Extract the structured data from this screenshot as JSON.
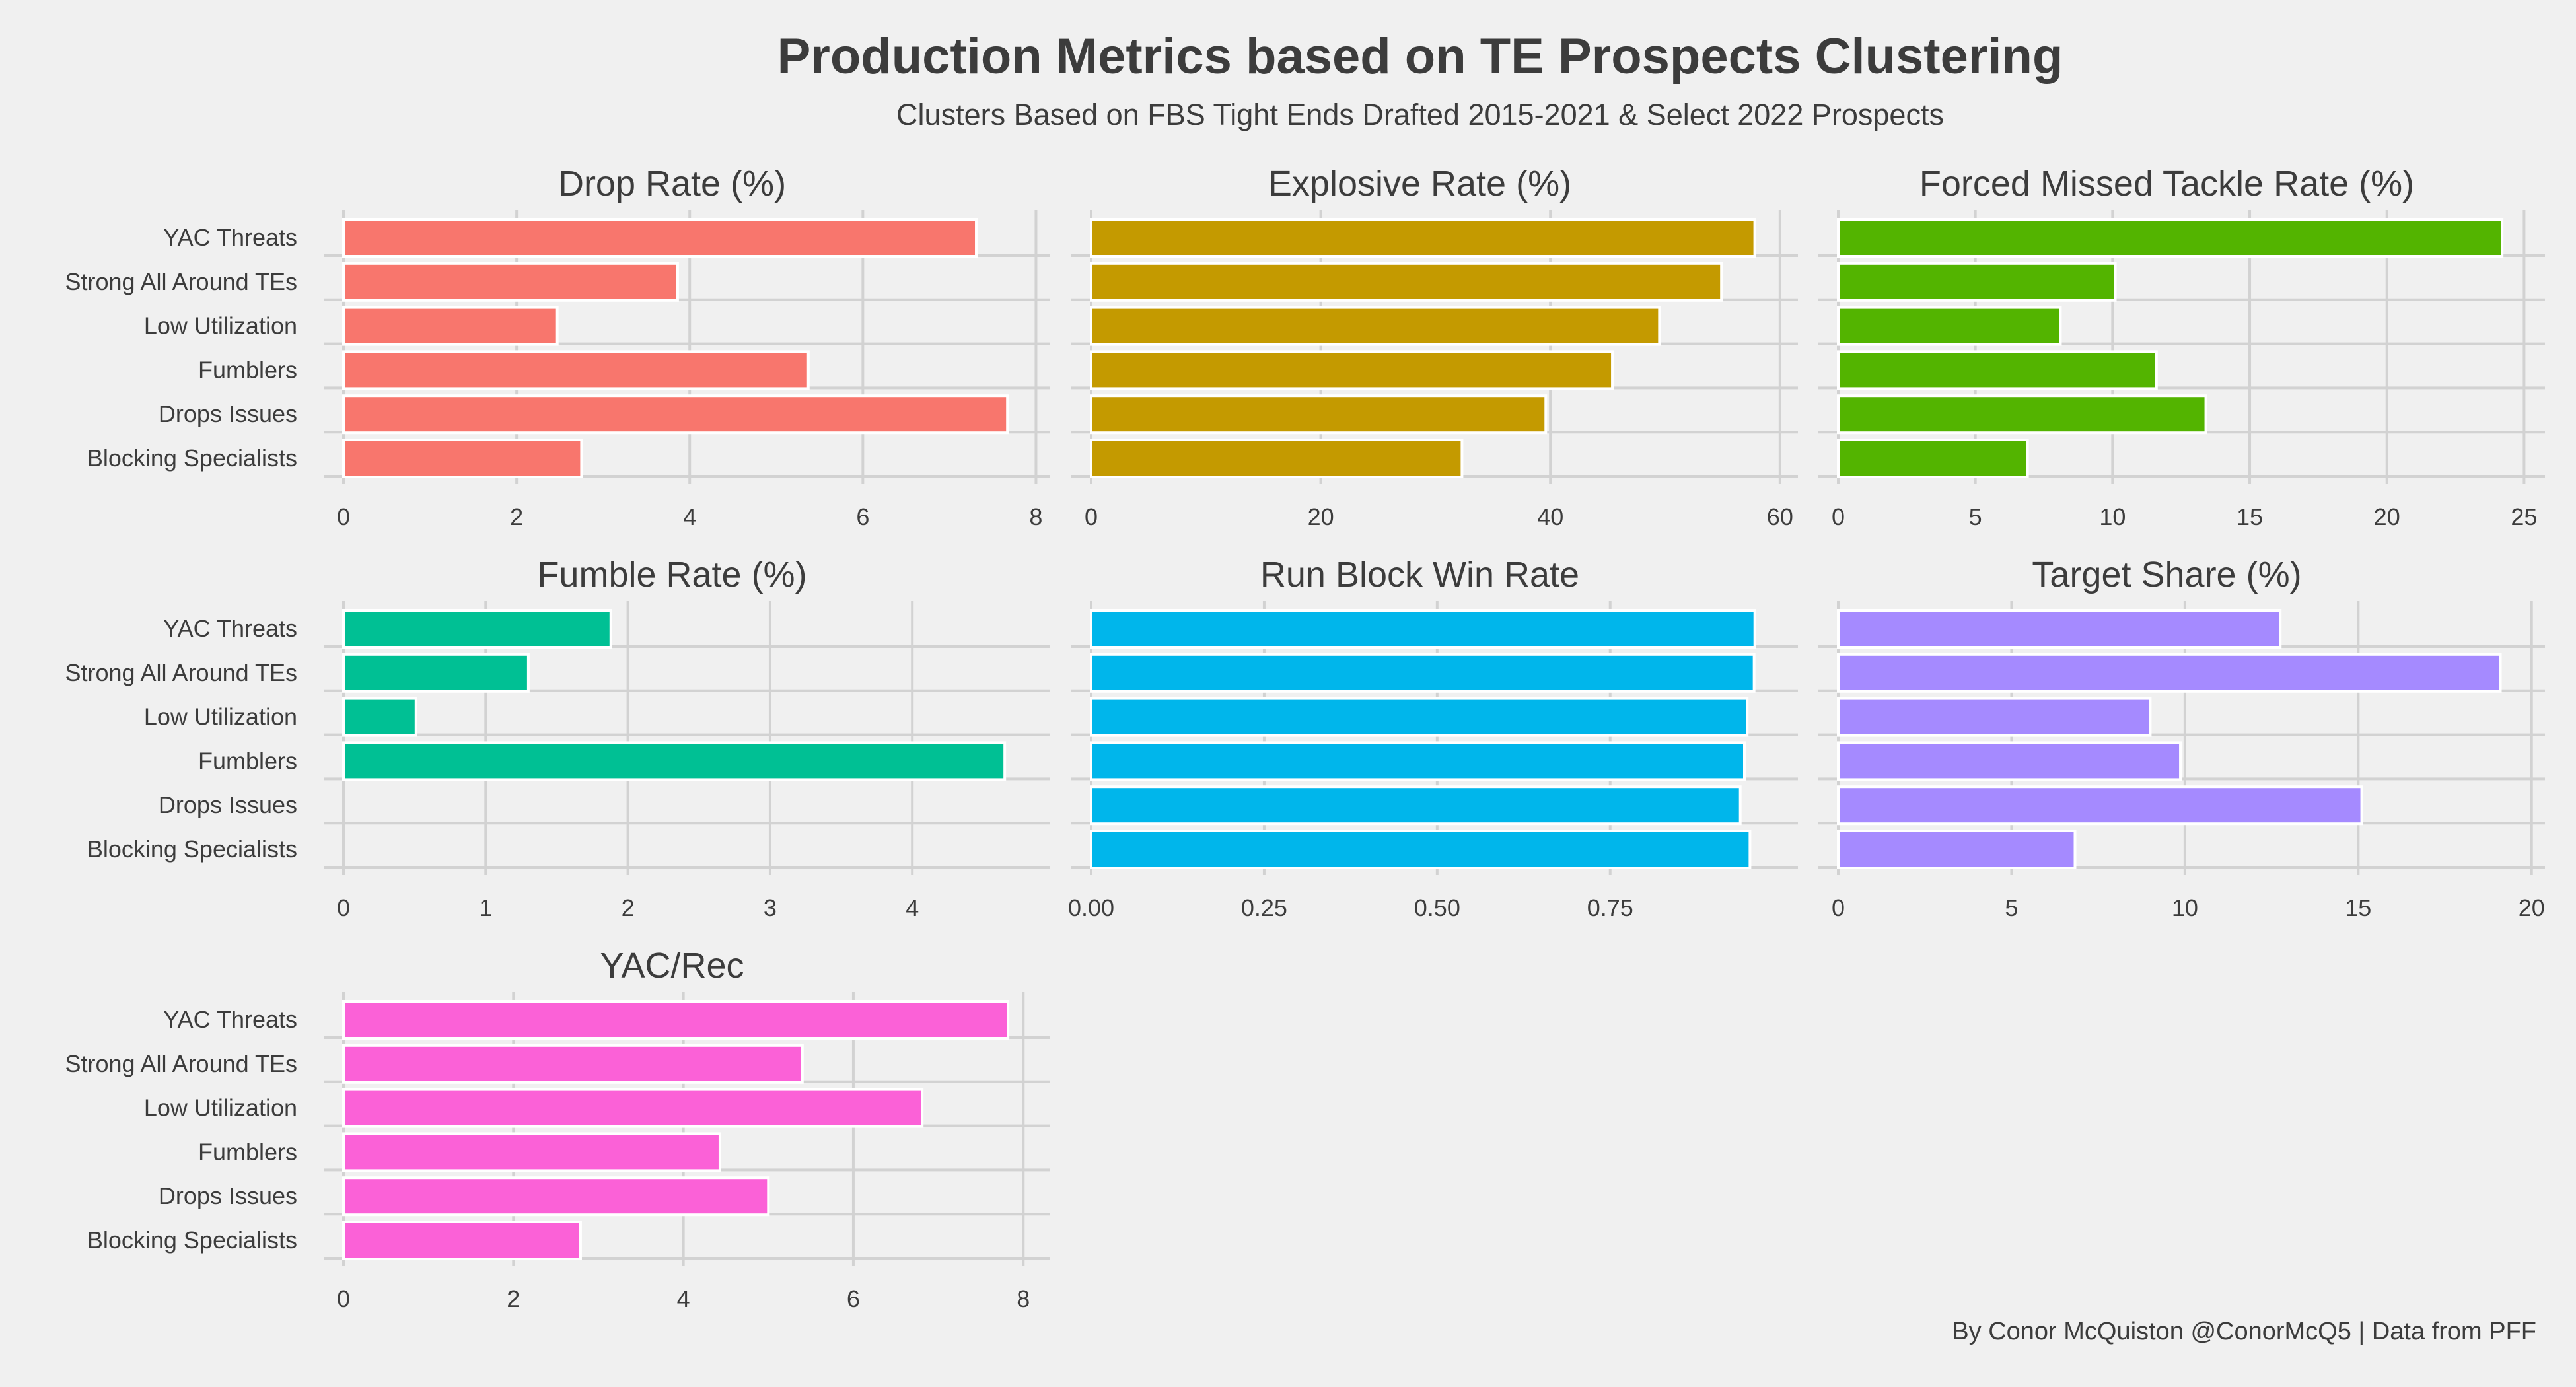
{
  "header": {
    "title": "Production Metrics based on TE Prospects Clustering",
    "subtitle": "Clusters Based on FBS Tight Ends Drafted 2015-2021 & Select 2022 Prospects"
  },
  "footer": {
    "caption": "By Conor McQuiston @ConorMcQ5 | Data from PFF"
  },
  "chart_data": [
    {
      "type": "bar",
      "orientation": "horizontal",
      "title": "Drop Rate (%)",
      "color": "#F8766D",
      "categories": [
        "YAC Threats",
        "Strong All Around TEs",
        "Low Utilization",
        "Fumblers",
        "Drops Issues",
        "Blocking Specialists"
      ],
      "values": [
        7.31,
        3.86,
        2.47,
        5.37,
        7.67,
        2.75
      ],
      "xlim": [
        0,
        8.05
      ],
      "ticks": [
        0,
        2,
        4,
        6,
        8
      ],
      "tick_labels": [
        "0",
        "2",
        "4",
        "6",
        "8"
      ],
      "grid": true
    },
    {
      "type": "bar",
      "orientation": "horizontal",
      "title": "Explosive Rate (%)",
      "color": "#C49A00",
      "categories": [
        "YAC Threats",
        "Strong All Around TEs",
        "Low Utilization",
        "Fumblers",
        "Drops Issues",
        "Blocking Specialists"
      ],
      "values": [
        57.8,
        54.9,
        49.5,
        45.4,
        39.6,
        32.3
      ],
      "xlim": [
        0,
        60.7
      ],
      "ticks": [
        0,
        20,
        40,
        60
      ],
      "tick_labels": [
        "0",
        "20",
        "40",
        "60"
      ],
      "grid": true
    },
    {
      "type": "bar",
      "orientation": "horizontal",
      "title": "Forced Missed Tackle Rate (%)",
      "color": "#53B400",
      "categories": [
        "YAC Threats",
        "Strong All Around TEs",
        "Low Utilization",
        "Fumblers",
        "Drops Issues",
        "Blocking Specialists"
      ],
      "values": [
        24.2,
        10.1,
        8.1,
        11.6,
        13.4,
        6.9
      ],
      "xlim": [
        0,
        25.4
      ],
      "ticks": [
        0,
        5,
        10,
        15,
        20,
        25
      ],
      "tick_labels": [
        "0",
        "5",
        "10",
        "15",
        "20",
        "25"
      ],
      "grid": true
    },
    {
      "type": "bar",
      "orientation": "horizontal",
      "title": "Fumble Rate (%)",
      "color": "#00C094",
      "categories": [
        "YAC Threats",
        "Strong All Around TEs",
        "Low Utilization",
        "Fumblers",
        "Drops Issues",
        "Blocking Specialists"
      ],
      "values": [
        1.88,
        1.3,
        0.51,
        4.65,
        0.0,
        0.0
      ],
      "xlim": [
        0,
        4.9
      ],
      "ticks": [
        0,
        1,
        2,
        3,
        4
      ],
      "tick_labels": [
        "0",
        "1",
        "2",
        "3",
        "4"
      ],
      "grid": true
    },
    {
      "type": "bar",
      "orientation": "horizontal",
      "title": "Run Block Win Rate",
      "color": "#00B6EB",
      "categories": [
        "YAC Threats",
        "Strong All Around TEs",
        "Low Utilization",
        "Fumblers",
        "Drops Issues",
        "Blocking Specialists"
      ],
      "values": [
        0.959,
        0.958,
        0.948,
        0.944,
        0.938,
        0.952
      ],
      "xlim": [
        0,
        1.007
      ],
      "ticks": [
        0,
        0.25,
        0.5,
        0.75
      ],
      "tick_labels": [
        "0.00",
        "0.25",
        "0.50",
        "0.75"
      ],
      "grid": true
    },
    {
      "type": "bar",
      "orientation": "horizontal",
      "title": "Target Share (%)",
      "color": "#A58AFF",
      "categories": [
        "YAC Threats",
        "Strong All Around TEs",
        "Low Utilization",
        "Fumblers",
        "Drops Issues",
        "Blocking Specialists"
      ],
      "values": [
        12.75,
        19.1,
        9.0,
        9.87,
        15.1,
        6.83
      ],
      "xlim": [
        0,
        20.1
      ],
      "ticks": [
        0,
        5,
        10,
        15,
        20
      ],
      "tick_labels": [
        "0",
        "5",
        "10",
        "15",
        "20"
      ],
      "grid": true
    },
    {
      "type": "bar",
      "orientation": "horizontal",
      "title": "YAC/Rec",
      "color": "#FB61D7",
      "categories": [
        "YAC Threats",
        "Strong All Around TEs",
        "Low Utilization",
        "Fumblers",
        "Drops Issues",
        "Blocking Specialists"
      ],
      "values": [
        7.82,
        5.4,
        6.81,
        4.43,
        5.0,
        2.79
      ],
      "xlim": [
        0,
        8.2
      ],
      "ticks": [
        0,
        2,
        4,
        6,
        8
      ],
      "tick_labels": [
        "0",
        "2",
        "4",
        "6",
        "8"
      ],
      "grid": true
    }
  ]
}
